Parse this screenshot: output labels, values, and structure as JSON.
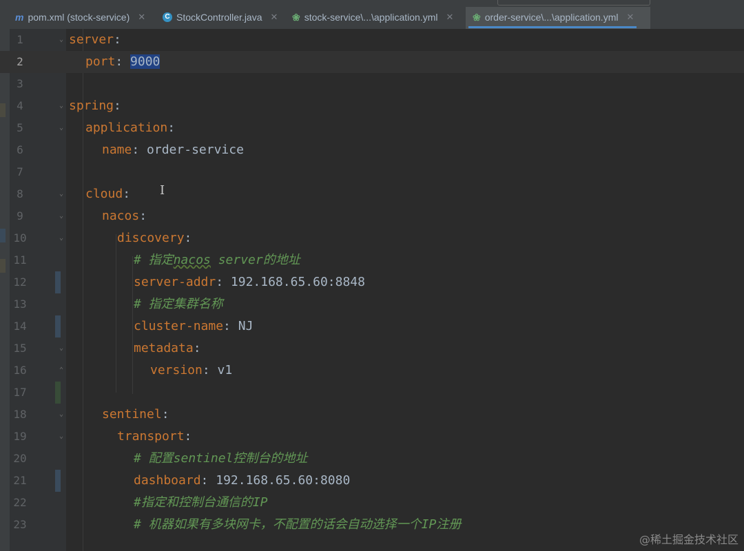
{
  "tabs": [
    {
      "icon": "m",
      "label": "pom.xml (stock-service)",
      "icon_name": "maven-icon"
    },
    {
      "icon": "C",
      "label": "StockController.java",
      "icon_name": "java-class-icon"
    },
    {
      "icon": "❀",
      "label": "stock-service\\...\\application.yml",
      "icon_name": "spring-yaml-icon"
    },
    {
      "icon": "❀",
      "label": "order-service\\...\\application.yml",
      "icon_name": "spring-yaml-icon",
      "active": true
    }
  ],
  "lines": [
    {
      "n": "1",
      "key": "server",
      "colon": ":",
      "val": ""
    },
    {
      "n": "2",
      "key": "port",
      "colon": ": ",
      "val": "9000"
    },
    {
      "n": "3"
    },
    {
      "n": "4",
      "key": "spring",
      "colon": ":"
    },
    {
      "n": "5",
      "key": "application",
      "colon": ":"
    },
    {
      "n": "6",
      "key": "name",
      "colon": ": ",
      "val": "order-service"
    },
    {
      "n": "7"
    },
    {
      "n": "8",
      "key": "cloud",
      "colon": ":"
    },
    {
      "n": "9",
      "key": "nacos",
      "colon": ":"
    },
    {
      "n": "10",
      "key": "discovery",
      "colon": ":"
    },
    {
      "n": "11",
      "comment_prefix": "# 指定",
      "comment_mid": "nacos",
      "comment_suffix": " server的地址"
    },
    {
      "n": "12",
      "key": "server-addr",
      "colon": ": ",
      "val": "192.168.65.60:8848"
    },
    {
      "n": "13",
      "comment": "# 指定集群名称"
    },
    {
      "n": "14",
      "key": "cluster-name",
      "colon": ": ",
      "val": "NJ"
    },
    {
      "n": "15",
      "key": "metadata",
      "colon": ":"
    },
    {
      "n": "16",
      "key": "version",
      "colon": ": ",
      "val": "v1"
    },
    {
      "n": "17"
    },
    {
      "n": "18",
      "key": "sentinel",
      "colon": ":"
    },
    {
      "n": "19",
      "key": "transport",
      "colon": ":"
    },
    {
      "n": "20",
      "comment": "# 配置sentinel控制台的地址"
    },
    {
      "n": "21",
      "key": "dashboard",
      "colon": ": ",
      "val": "192.168.65.60:8080"
    },
    {
      "n": "22",
      "comment": "#指定和控制台通信的IP"
    },
    {
      "n": "23",
      "comment": "# 机器如果有多块网卡，不配置的话会自动选择一个IP注册"
    }
  ],
  "watermark": "@稀土掘金技术社区",
  "colors": {
    "key": "#cc7832",
    "value": "#a9b7c6",
    "comment": "#629755",
    "selection": "#214283",
    "background": "#2b2b2b"
  }
}
